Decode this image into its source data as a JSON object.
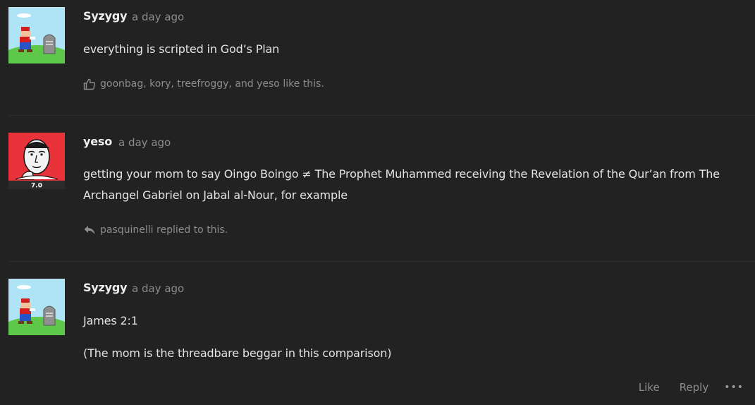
{
  "posts": [
    {
      "author": "Syzygy",
      "time": "a day ago",
      "paragraphs": [
        "everything is scripted in God’s Plan"
      ],
      "meta_text": "goonbag, kory, treefroggy, and yeso like this.",
      "meta_icon": "thumbs-up-icon"
    },
    {
      "author": "yeso",
      "time": "a day ago",
      "avatar_badge": "7.0",
      "paragraphs": [
        "getting your mom to say Oingo Boingo ≠ The Prophet Muhammed receiving the Revelation of the Qur’an from The Archangel Gabriel on Jabal al-Nour, for example"
      ],
      "meta_text": "pasquinelli replied to this.",
      "meta_icon": "reply-icon"
    },
    {
      "author": "Syzygy",
      "time": "a day ago",
      "paragraphs": [
        "James 2:1",
        "(The mom is the threadbare beggar in this comparison)"
      ]
    }
  ],
  "actions": {
    "like": "Like",
    "reply": "Reply",
    "more": "•••"
  },
  "colors": {
    "background": "#222222",
    "text": "#e4e4e4",
    "muted": "#8c8c8c"
  }
}
